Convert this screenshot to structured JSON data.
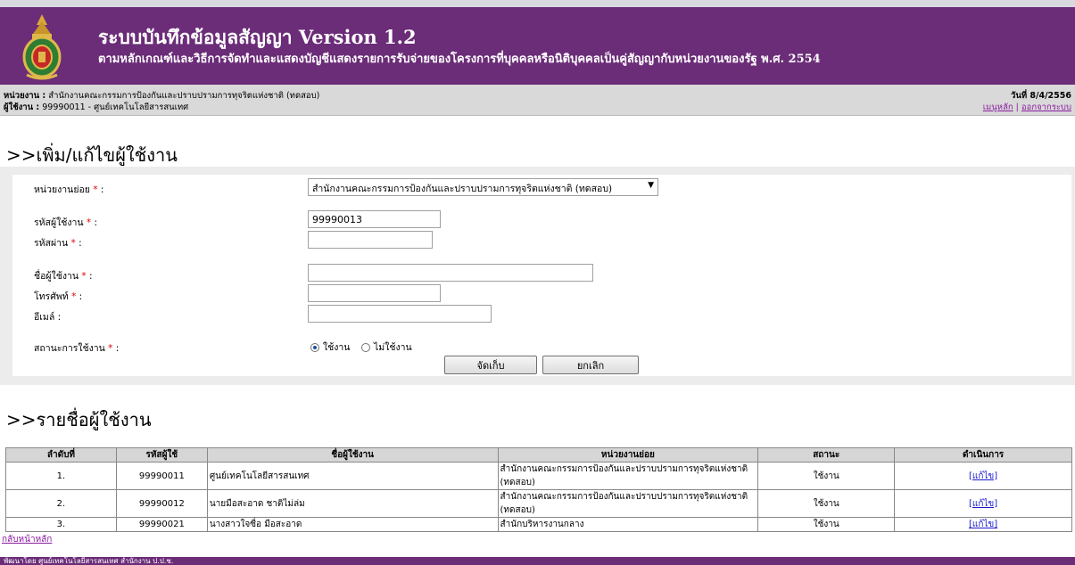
{
  "header": {
    "title": "ระบบบันทึกข้อมูลสัญญา Version 1.2",
    "subtitle": "ตามหลักเกณฑ์และวิธีการจัดทำและแสดงบัญชีแสดงรายการรับจ่ายของโครงการที่บุคคลหรือนิติบุคคลเป็นคู่สัญญากับหน่วยงานของรัฐ พ.ศ. 2554",
    "logo_icon": "government-seal-icon"
  },
  "infobar": {
    "agency_label": "หน่วยงาน :",
    "agency_value": "สำนักงานคณะกรรมการป้องกันและปราบปรามการทุจริตแห่งชาติ (ทดสอบ)",
    "user_label": "ผู้ใช้งาน :",
    "user_value": "99990011 - ศูนย์เทคโนโลยีสารสนเทศ",
    "date": "วันที่ 8/4/2556",
    "main_menu": "เมนูหลัก",
    "separator": "|",
    "logout": "ออกจากระบบ"
  },
  "form": {
    "section_title": ">>เพิ่ม/แก้ไขผู้ใช้งาน",
    "subunit_label": "หน่วยงานย่อย",
    "subunit_value": "สำนักงานคณะกรรมการป้องกันและปราบปรามการทุจริตแห่งชาติ (ทดสอบ)",
    "user_id_label": "รหัสผู้ใช้งาน",
    "user_id_value": "99990013",
    "password_label": "รหัสผ่าน",
    "password_value": "",
    "username_label": "ชื่อผู้ใช้งาน",
    "username_value": "",
    "phone_label": "โทรศัพท์",
    "phone_value": "",
    "email_label": "อีเมล์ :",
    "email_value": "",
    "status_label": "สถานะการใช้งาน",
    "required_mark": "*",
    "colon": ":",
    "status_options": [
      "ใช้งาน",
      "ไม่ใช้งาน"
    ],
    "status_selected": "ใช้งาน",
    "save_label": "จัดเก็บ",
    "cancel_label": "ยกเลิก"
  },
  "list": {
    "section_title": ">>รายชื่อผู้ใช้งาน",
    "columns": [
      "ลำดับที่",
      "รหัสผู้ใช้",
      "ชื่อผู้ใช้งาน",
      "หน่วยงานย่อย",
      "สถานะ",
      "ดำเนินการ"
    ],
    "rows": [
      {
        "no": "1.",
        "id": "99990011",
        "name": "ศูนย์เทคโนโลยีสารสนเทศ",
        "unit": "สำนักงานคณะกรรมการป้องกันและปราบปรามการทุจริตแห่งชาติ (ทดสอบ)",
        "status": "ใช้งาน",
        "action": "[แก้ไข]"
      },
      {
        "no": "2.",
        "id": "99990012",
        "name": "นายมือสะอาด ชาติไม่ล่ม",
        "unit": "สำนักงานคณะกรรมการป้องกันและปราบปรามการทุจริตแห่งชาติ (ทดสอบ)",
        "status": "ใช้งาน",
        "action": "[แก้ไข]"
      },
      {
        "no": "3.",
        "id": "99990021",
        "name": "นางสาวใจซื่อ มือสะอาด",
        "unit": "สำนักบริหารงานกลาง",
        "status": "ใช้งาน",
        "action": "[แก้ไข]"
      }
    ]
  },
  "footer": {
    "back_link": "กลับหน้าหลัก",
    "credit": "พัฒนาโดย ศูนย์เทคโนโลยีสารสนเทศ สำนักงาน ป.ป.ช."
  },
  "colors": {
    "brand": "#6b2c78",
    "link": "#8a1aa0",
    "required": "#e00000"
  }
}
